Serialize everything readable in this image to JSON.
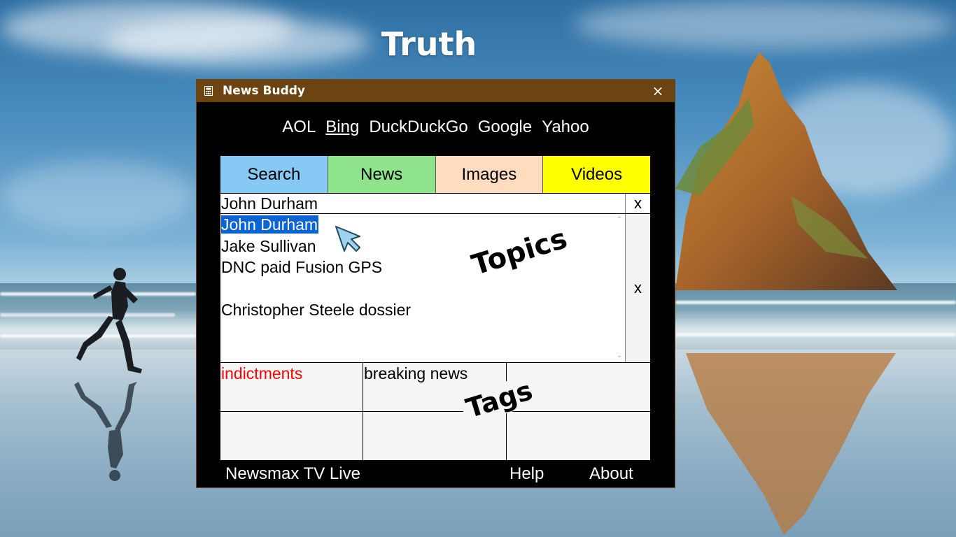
{
  "desktop": {
    "title": "Truth"
  },
  "window": {
    "title": "News Buddy",
    "icon": "app-window-icon",
    "close_label": "×"
  },
  "engines": {
    "items": [
      "AOL",
      "Bing",
      "DuckDuckGo",
      "Google",
      "Yahoo"
    ],
    "selected": "Bing"
  },
  "tabs": [
    {
      "label": "Search",
      "color": "#87c9f5"
    },
    {
      "label": "News",
      "color": "#8fe38a"
    },
    {
      "label": "Images",
      "color": "#ffdcc0"
    },
    {
      "label": "Videos",
      "color": "#ffff00"
    }
  ],
  "search": {
    "value": "John Durham",
    "clear_label": "x"
  },
  "topics": {
    "items": [
      "John Durham",
      "Jake Sullivan",
      "DNC paid Fusion GPS",
      "",
      "Christopher Steele dossier"
    ],
    "selected": "John Durham",
    "clear_label": "x",
    "overlay_label": "Topics"
  },
  "tags": {
    "cells": [
      {
        "label": "indictments",
        "color": "#ff0000"
      },
      {
        "label": "breaking news",
        "color": "#000000"
      },
      {
        "label": "",
        "color": "#000000"
      },
      {
        "label": "",
        "color": "#000000"
      },
      {
        "label": "",
        "color": "#000000"
      },
      {
        "label": "",
        "color": "#000000"
      }
    ],
    "overlay_label": "Tags"
  },
  "footer": {
    "left": "Newsmax TV Live",
    "help": "Help",
    "about": "About"
  },
  "colors": {
    "titlebar": "#6b4411",
    "window_bg": "#000000",
    "selection": "#0a64d4",
    "cursor_fill": "#9fd3ec"
  }
}
